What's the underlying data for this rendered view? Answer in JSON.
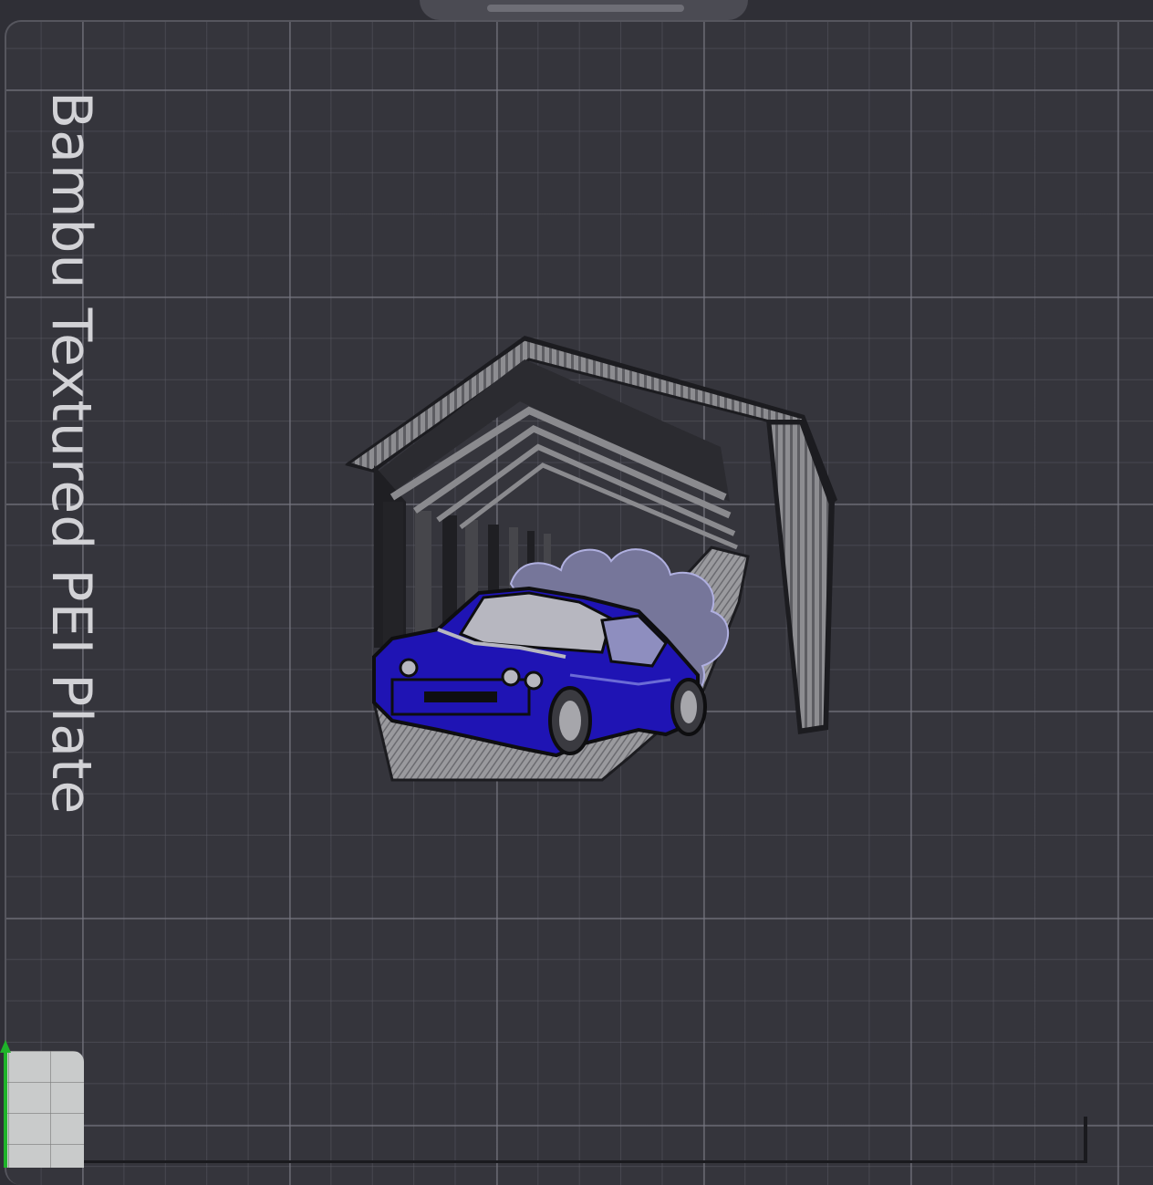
{
  "plate": {
    "label": "Bambu Textured PEI Plate"
  },
  "model": {
    "icon": "garage-drift-car-model",
    "colors": {
      "car_body": "#1f14b4",
      "structure": "#8f8f93",
      "outline": "#1c1c20"
    }
  },
  "axes": {
    "y_color": "#1fb32a"
  },
  "theme": {
    "background": "#2f2f36",
    "plate": "#35353c",
    "grid": "#6f6f7a"
  }
}
